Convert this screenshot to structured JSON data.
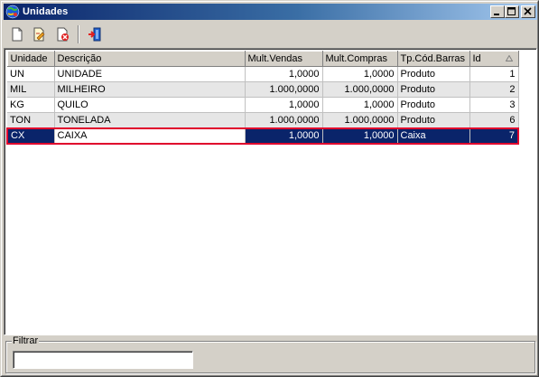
{
  "window": {
    "title": "Unidades",
    "icon": "app-globe-icon"
  },
  "titlebar_buttons": [
    "minimize-icon",
    "maximize-icon",
    "close-icon"
  ],
  "toolbar": {
    "buttons": [
      {
        "name": "new-document-icon"
      },
      {
        "name": "edit-document-icon"
      },
      {
        "name": "delete-document-icon"
      },
      {
        "name": "exit-door-icon"
      }
    ]
  },
  "grid": {
    "columns": [
      "Unidade",
      "Descrição",
      "Mult.Vendas",
      "Mult.Compras",
      "Tp.Cód.Barras",
      "Id"
    ],
    "sorted_column": "Id",
    "sort_direction": "ascending",
    "rows": [
      {
        "unidade": "UN",
        "descricao": "UNIDADE",
        "mult_vendas": "1,0000",
        "mult_compras": "1,0000",
        "tp_cod_barras": "Produto",
        "id": "1"
      },
      {
        "unidade": "MIL",
        "descricao": "MILHEIRO",
        "mult_vendas": "1.000,0000",
        "mult_compras": "1.000,0000",
        "tp_cod_barras": "Produto",
        "id": "2"
      },
      {
        "unidade": "KG",
        "descricao": "QUILO",
        "mult_vendas": "1,0000",
        "mult_compras": "1,0000",
        "tp_cod_barras": "Produto",
        "id": "3"
      },
      {
        "unidade": "TON",
        "descricao": "TONELADA",
        "mult_vendas": "1.000,0000",
        "mult_compras": "1.000,0000",
        "tp_cod_barras": "Produto",
        "id": "6"
      },
      {
        "unidade": "CX",
        "descricao": "CAIXA",
        "mult_vendas": "1,0000",
        "mult_compras": "1,0000",
        "tp_cod_barras": "Caixa",
        "id": "7"
      }
    ],
    "selected_row_index": 4,
    "colors": {
      "selection": "#0a246a",
      "selection_border": "#e0002c",
      "alt_row": "#e6e6e6"
    }
  },
  "filter": {
    "label": "Filtrar",
    "value": "",
    "placeholder": ""
  }
}
